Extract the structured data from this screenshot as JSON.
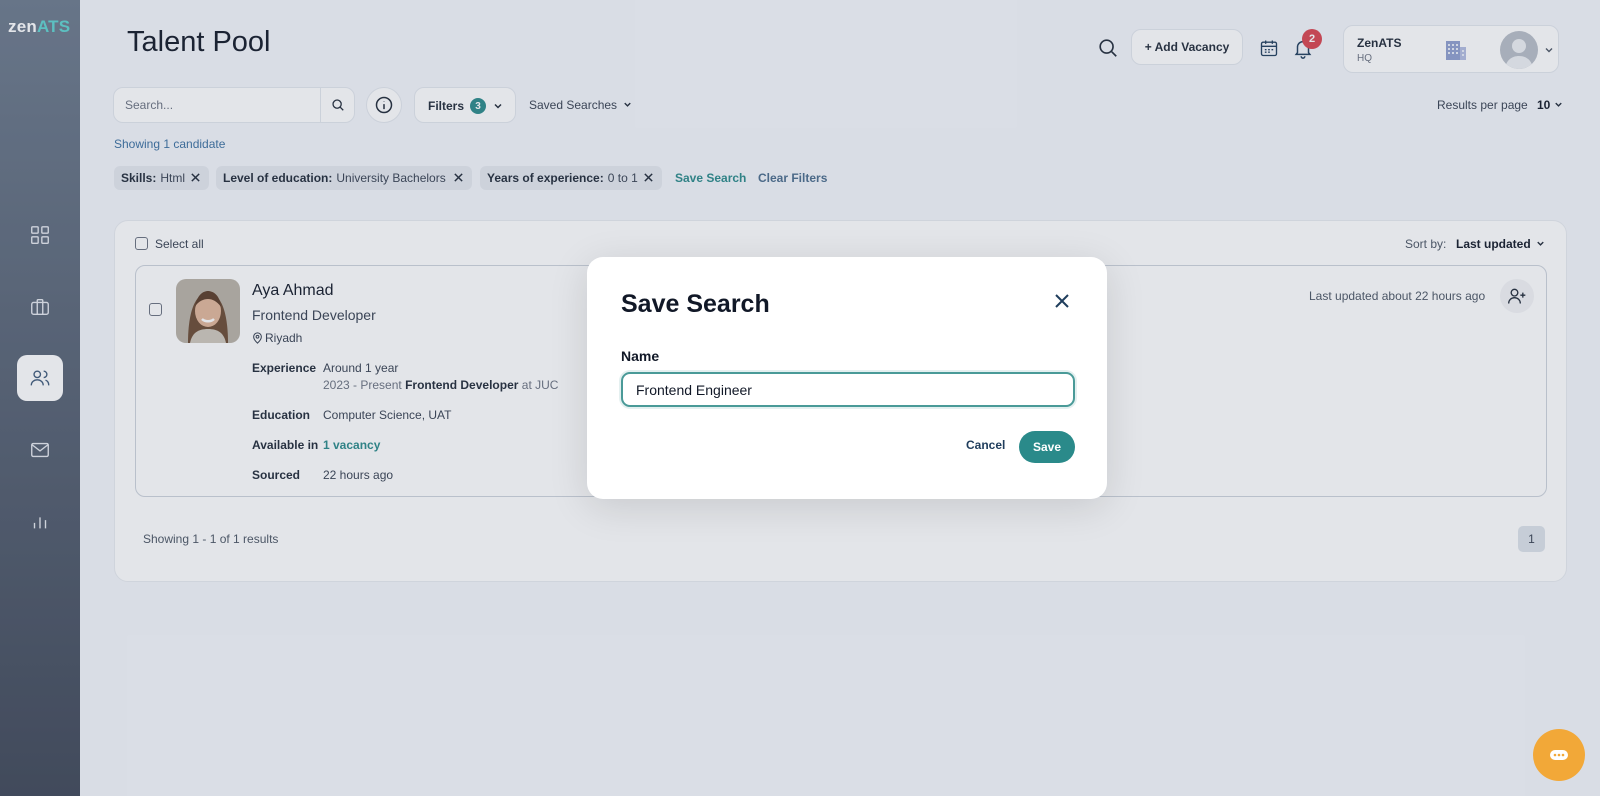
{
  "app": {
    "logo_zen": "zen",
    "logo_ats": "ATS"
  },
  "colors": {
    "accent": "#2a8a8a",
    "sidebar_top": "#6c7a8c",
    "sidebar_bottom": "#3f4757",
    "badge": "#d9434e",
    "fab": "#f2a838"
  },
  "sidebar": {
    "items": [
      {
        "icon": "dashboard-grid-icon",
        "active": false
      },
      {
        "icon": "briefcase-icon",
        "active": false
      },
      {
        "icon": "users-icon",
        "active": true
      },
      {
        "icon": "mail-icon",
        "active": false
      },
      {
        "icon": "bar-chart-icon",
        "active": false
      }
    ]
  },
  "header": {
    "title": "Talent Pool",
    "add_vacancy_label": "+ Add Vacancy",
    "notification_count": "2",
    "account": {
      "name": "ZenATS",
      "sub": "HQ"
    }
  },
  "toolbar": {
    "search_placeholder": "Search...",
    "filters_label": "Filters",
    "filters_count": "3",
    "saved_searches_label": "Saved Searches",
    "results_per_page_label": "Results per page",
    "results_per_page_value": "10",
    "showing_count": "Showing 1 candidate"
  },
  "chips": [
    {
      "key": "Skills:",
      "value": "Html"
    },
    {
      "key": "Level of education:",
      "value": "University Bachelors"
    },
    {
      "key": "Years of experience:",
      "value": "0 to 1"
    }
  ],
  "chip_actions": {
    "save_search": "Save Search",
    "clear_filters": "Clear Filters"
  },
  "results": {
    "select_all_label": "Select all",
    "sort_label": "Sort by:",
    "sort_value": "Last updated",
    "candidate": {
      "name": "Aya Ahmad",
      "role": "Frontend Developer",
      "location": "Riyadh",
      "experience_label": "Experience",
      "experience_summary": "Around 1 year",
      "experience_period": "2023 - Present",
      "experience_title": "Frontend Developer",
      "experience_at": "at JUC",
      "education_label": "Education",
      "education_value": "Computer Science, UAT",
      "available_label": "Available in",
      "available_value": "1 vacancy",
      "sourced_label": "Sourced",
      "sourced_value": "22 hours ago",
      "last_updated": "Last updated about 22 hours ago"
    },
    "footer_text": "Showing 1 - 1 of 1 results",
    "current_page": "1"
  },
  "modal": {
    "title": "Save Search",
    "name_label": "Name",
    "name_value": "Frontend Engineer",
    "cancel_label": "Cancel",
    "save_label": "Save"
  }
}
